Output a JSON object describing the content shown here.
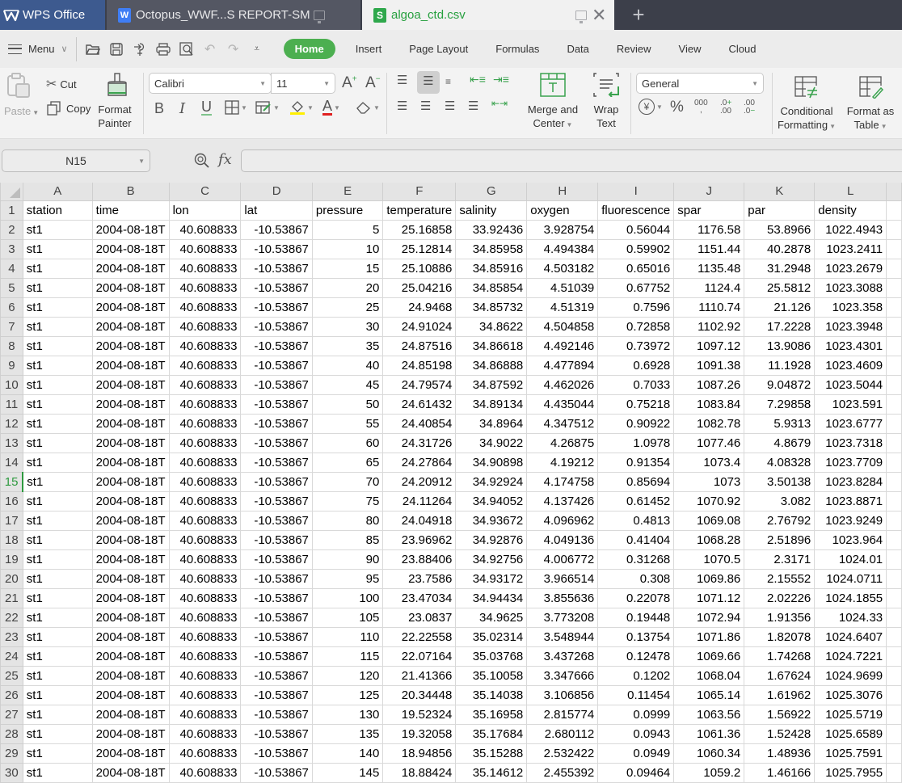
{
  "tabs": {
    "app": {
      "label": "WPS Office"
    },
    "doc": {
      "label": "Octopus_WWF...S REPORT-SM"
    },
    "csv": {
      "label": "algoa_ctd.csv"
    },
    "new_tab": "+"
  },
  "menubar": {
    "menu_label": "Menu",
    "tabs": [
      "Home",
      "Insert",
      "Page Layout",
      "Formulas",
      "Data",
      "Review",
      "View",
      "Cloud"
    ],
    "active_tab": "Home"
  },
  "ribbon": {
    "paste": "Paste",
    "cut": "Cut",
    "copy": "Copy",
    "format_painter_1": "Format",
    "format_painter_2": "Painter",
    "font_name": "Calibri",
    "font_size": "11",
    "bold": "B",
    "italic": "I",
    "underline": "U",
    "merge_1": "Merge and",
    "merge_2": "Center",
    "wrap_1": "Wrap",
    "wrap_2": "Text",
    "number_format": "General",
    "cond_1": "Conditional",
    "cond_2": "Formatting",
    "fmt_table_1": "Format as",
    "fmt_table_2": "Table"
  },
  "formula_bar": {
    "cell_ref": "N15",
    "fx": "fx",
    "formula": ""
  },
  "sheet": {
    "active_row": 15,
    "columns": [
      "A",
      "B",
      "C",
      "D",
      "E",
      "F",
      "G",
      "H",
      "I",
      "J",
      "K",
      "L"
    ],
    "headers": [
      "station",
      "time",
      "lon",
      "lat",
      "pressure",
      "temperature",
      "salinity",
      "oxygen",
      "fluorescence",
      "spar",
      "par",
      "density"
    ],
    "rows": [
      [
        "st1",
        "2004-08-18T",
        "40.608833",
        "-10.53867",
        "5",
        "25.16858",
        "33.92436",
        "3.928754",
        "0.56044",
        "1176.58",
        "53.8966",
        "1022.4943"
      ],
      [
        "st1",
        "2004-08-18T",
        "40.608833",
        "-10.53867",
        "10",
        "25.12814",
        "34.85958",
        "4.494384",
        "0.59902",
        "1151.44",
        "40.2878",
        "1023.2411"
      ],
      [
        "st1",
        "2004-08-18T",
        "40.608833",
        "-10.53867",
        "15",
        "25.10886",
        "34.85916",
        "4.503182",
        "0.65016",
        "1135.48",
        "31.2948",
        "1023.2679"
      ],
      [
        "st1",
        "2004-08-18T",
        "40.608833",
        "-10.53867",
        "20",
        "25.04216",
        "34.85854",
        "4.51039",
        "0.67752",
        "1124.4",
        "25.5812",
        "1023.3088"
      ],
      [
        "st1",
        "2004-08-18T",
        "40.608833",
        "-10.53867",
        "25",
        "24.9468",
        "34.85732",
        "4.51319",
        "0.7596",
        "1110.74",
        "21.126",
        "1023.358"
      ],
      [
        "st1",
        "2004-08-18T",
        "40.608833",
        "-10.53867",
        "30",
        "24.91024",
        "34.8622",
        "4.504858",
        "0.72858",
        "1102.92",
        "17.2228",
        "1023.3948"
      ],
      [
        "st1",
        "2004-08-18T",
        "40.608833",
        "-10.53867",
        "35",
        "24.87516",
        "34.86618",
        "4.492146",
        "0.73972",
        "1097.12",
        "13.9086",
        "1023.4301"
      ],
      [
        "st1",
        "2004-08-18T",
        "40.608833",
        "-10.53867",
        "40",
        "24.85198",
        "34.86888",
        "4.477894",
        "0.6928",
        "1091.38",
        "11.1928",
        "1023.4609"
      ],
      [
        "st1",
        "2004-08-18T",
        "40.608833",
        "-10.53867",
        "45",
        "24.79574",
        "34.87592",
        "4.462026",
        "0.7033",
        "1087.26",
        "9.04872",
        "1023.5044"
      ],
      [
        "st1",
        "2004-08-18T",
        "40.608833",
        "-10.53867",
        "50",
        "24.61432",
        "34.89134",
        "4.435044",
        "0.75218",
        "1083.84",
        "7.29858",
        "1023.591"
      ],
      [
        "st1",
        "2004-08-18T",
        "40.608833",
        "-10.53867",
        "55",
        "24.40854",
        "34.8964",
        "4.347512",
        "0.90922",
        "1082.78",
        "5.9313",
        "1023.6777"
      ],
      [
        "st1",
        "2004-08-18T",
        "40.608833",
        "-10.53867",
        "60",
        "24.31726",
        "34.9022",
        "4.26875",
        "1.0978",
        "1077.46",
        "4.8679",
        "1023.7318"
      ],
      [
        "st1",
        "2004-08-18T",
        "40.608833",
        "-10.53867",
        "65",
        "24.27864",
        "34.90898",
        "4.19212",
        "0.91354",
        "1073.4",
        "4.08328",
        "1023.7709"
      ],
      [
        "st1",
        "2004-08-18T",
        "40.608833",
        "-10.53867",
        "70",
        "24.20912",
        "34.92924",
        "4.174758",
        "0.85694",
        "1073",
        "3.50138",
        "1023.8284"
      ],
      [
        "st1",
        "2004-08-18T",
        "40.608833",
        "-10.53867",
        "75",
        "24.11264",
        "34.94052",
        "4.137426",
        "0.61452",
        "1070.92",
        "3.082",
        "1023.8871"
      ],
      [
        "st1",
        "2004-08-18T",
        "40.608833",
        "-10.53867",
        "80",
        "24.04918",
        "34.93672",
        "4.096962",
        "0.4813",
        "1069.08",
        "2.76792",
        "1023.9249"
      ],
      [
        "st1",
        "2004-08-18T",
        "40.608833",
        "-10.53867",
        "85",
        "23.96962",
        "34.92876",
        "4.049136",
        "0.41404",
        "1068.28",
        "2.51896",
        "1023.964"
      ],
      [
        "st1",
        "2004-08-18T",
        "40.608833",
        "-10.53867",
        "90",
        "23.88406",
        "34.92756",
        "4.006772",
        "0.31268",
        "1070.5",
        "2.3171",
        "1024.01"
      ],
      [
        "st1",
        "2004-08-18T",
        "40.608833",
        "-10.53867",
        "95",
        "23.7586",
        "34.93172",
        "3.966514",
        "0.308",
        "1069.86",
        "2.15552",
        "1024.0711"
      ],
      [
        "st1",
        "2004-08-18T",
        "40.608833",
        "-10.53867",
        "100",
        "23.47034",
        "34.94434",
        "3.855636",
        "0.22078",
        "1071.12",
        "2.02226",
        "1024.1855"
      ],
      [
        "st1",
        "2004-08-18T",
        "40.608833",
        "-10.53867",
        "105",
        "23.0837",
        "34.9625",
        "3.773208",
        "0.19448",
        "1072.94",
        "1.91356",
        "1024.33"
      ],
      [
        "st1",
        "2004-08-18T",
        "40.608833",
        "-10.53867",
        "110",
        "22.22558",
        "35.02314",
        "3.548944",
        "0.13754",
        "1071.86",
        "1.82078",
        "1024.6407"
      ],
      [
        "st1",
        "2004-08-18T",
        "40.608833",
        "-10.53867",
        "115",
        "22.07164",
        "35.03768",
        "3.437268",
        "0.12478",
        "1069.66",
        "1.74268",
        "1024.7221"
      ],
      [
        "st1",
        "2004-08-18T",
        "40.608833",
        "-10.53867",
        "120",
        "21.41366",
        "35.10058",
        "3.347666",
        "0.1202",
        "1068.04",
        "1.67624",
        "1024.9699"
      ],
      [
        "st1",
        "2004-08-18T",
        "40.608833",
        "-10.53867",
        "125",
        "20.34448",
        "35.14038",
        "3.106856",
        "0.11454",
        "1065.14",
        "1.61962",
        "1025.3076"
      ],
      [
        "st1",
        "2004-08-18T",
        "40.608833",
        "-10.53867",
        "130",
        "19.52324",
        "35.16958",
        "2.815774",
        "0.0999",
        "1063.56",
        "1.56922",
        "1025.5719"
      ],
      [
        "st1",
        "2004-08-18T",
        "40.608833",
        "-10.53867",
        "135",
        "19.32058",
        "35.17684",
        "2.680112",
        "0.0943",
        "1061.36",
        "1.52428",
        "1025.6589"
      ],
      [
        "st1",
        "2004-08-18T",
        "40.608833",
        "-10.53867",
        "140",
        "18.94856",
        "35.15288",
        "2.532422",
        "0.0949",
        "1060.34",
        "1.48936",
        "1025.7591"
      ],
      [
        "st1",
        "2004-08-18T",
        "40.608833",
        "-10.53867",
        "145",
        "18.88424",
        "35.14612",
        "2.455392",
        "0.09464",
        "1059.2",
        "1.46166",
        "1025.7955"
      ]
    ]
  }
}
